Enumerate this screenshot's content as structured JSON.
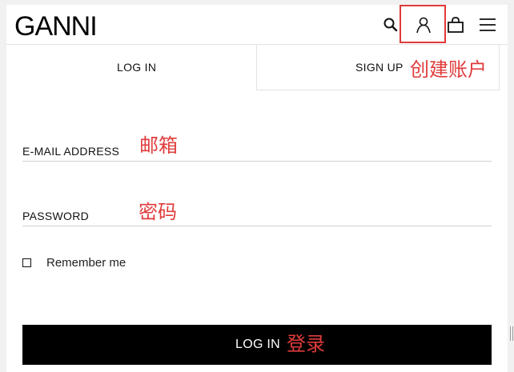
{
  "header": {
    "logo": "GANNI",
    "icons": [
      "search-icon",
      "account-icon",
      "bag-icon",
      "menu-icon"
    ]
  },
  "tabs": {
    "login_label": "LOG IN",
    "signup_label": "SIGN UP"
  },
  "form": {
    "email_label": "E-MAIL ADDRESS",
    "email_value": "",
    "password_label": "PASSWORD",
    "password_value": "",
    "remember_label": "Remember me",
    "remember_checked": false,
    "submit_label": "LOG IN"
  },
  "annotations": {
    "create_account": "创建账户",
    "email": "邮箱",
    "password": "密码",
    "login": "登录"
  },
  "colors": {
    "annotation": "#e03b3b",
    "button_bg": "#000000",
    "page_bg": "#ffffff",
    "outer_bg": "#f1f1f1"
  }
}
